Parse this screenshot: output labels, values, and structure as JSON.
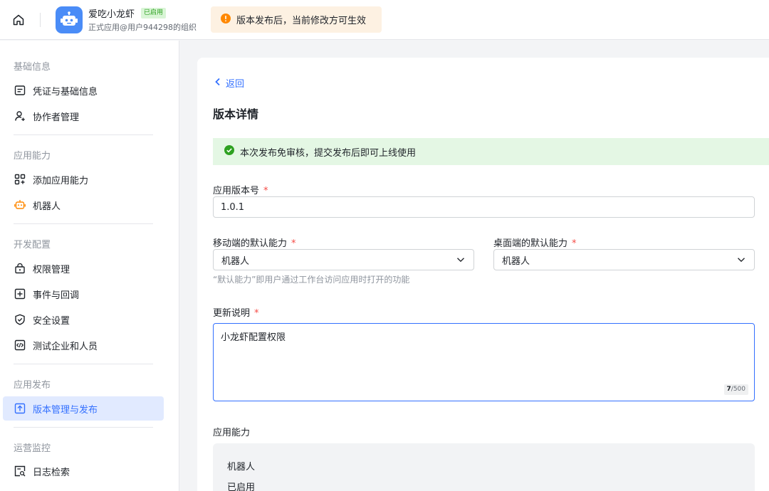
{
  "header": {
    "app_name": "爱吃小龙虾",
    "app_status": "已启用",
    "app_org": "正式应用@用户944298的组织",
    "notice": "版本发布后，当前修改方可生效"
  },
  "sidebar": {
    "groups": [
      {
        "title": "基础信息",
        "items": [
          {
            "label": "凭证与基础信息",
            "icon": "credential-icon"
          },
          {
            "label": "协作者管理",
            "icon": "user-add-icon"
          }
        ]
      },
      {
        "title": "应用能力",
        "items": [
          {
            "label": "添加应用能力",
            "icon": "grid-add-icon"
          },
          {
            "label": "机器人",
            "icon": "robot-icon"
          }
        ]
      },
      {
        "title": "开发配置",
        "items": [
          {
            "label": "权限管理",
            "icon": "lock-icon"
          },
          {
            "label": "事件与回调",
            "icon": "event-icon"
          },
          {
            "label": "安全设置",
            "icon": "shield-icon"
          },
          {
            "label": "测试企业和人员",
            "icon": "code-icon"
          }
        ]
      },
      {
        "title": "应用发布",
        "items": [
          {
            "label": "版本管理与发布",
            "icon": "upload-icon",
            "active": true
          }
        ]
      },
      {
        "title": "运营监控",
        "items": [
          {
            "label": "日志检索",
            "icon": "log-search-icon"
          }
        ]
      }
    ]
  },
  "main": {
    "back_label": "返回",
    "page_title": "版本详情",
    "success_message": "本次发布免审核，提交发布后即可上线使用",
    "version": {
      "label": "应用版本号",
      "required": "*",
      "value": "1.0.1"
    },
    "mobile_default": {
      "label": "移动端的默认能力",
      "required": "*",
      "value": "机器人"
    },
    "desktop_default": {
      "label": "桌面端的默认能力",
      "required": "*",
      "value": "机器人"
    },
    "default_hint": "“默认能力”即用户通过工作台访问应用时打开的功能",
    "update_notes": {
      "label": "更新说明",
      "required": "*",
      "value": "小龙虾配置权限",
      "count": "7",
      "max": "/500"
    },
    "capabilities": {
      "title": "应用能力",
      "name": "机器人",
      "status": "已启用"
    }
  },
  "colors": {
    "accent": "#3370ff",
    "success": "#2ea121",
    "warning": "#ff8800",
    "required": "#f54a45",
    "robot_icon": "#ff8800"
  }
}
